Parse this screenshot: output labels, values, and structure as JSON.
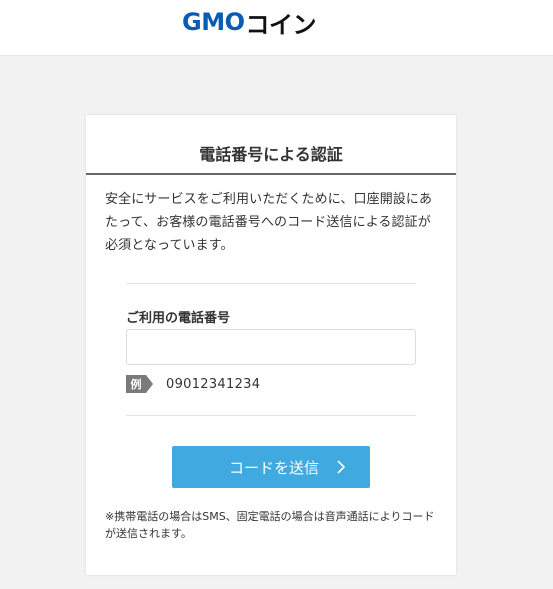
{
  "header": {
    "logo_brand": "GMO",
    "logo_sub": "コイン"
  },
  "card": {
    "title": "電話番号による認証",
    "intro": "安全にサービスをご利用いただくために、口座開設にあたって、お客様の電話番号へのコード送信による認証が必須となっています。",
    "phone_label": "ご利用の電話番号",
    "phone_value": "",
    "example_tag": "例",
    "example_value": "09012341234",
    "send_button_label": "コードを送信",
    "note": "※携帯電話の場合はSMS、固定電話の場合は音声通話によりコードが送信されます。"
  },
  "colors": {
    "brand_blue": "#0a5bb3",
    "button_blue": "#3fa9e0",
    "background": "#f2f2f2"
  },
  "icons": {
    "send_button_icon": "chevron-right-icon"
  }
}
